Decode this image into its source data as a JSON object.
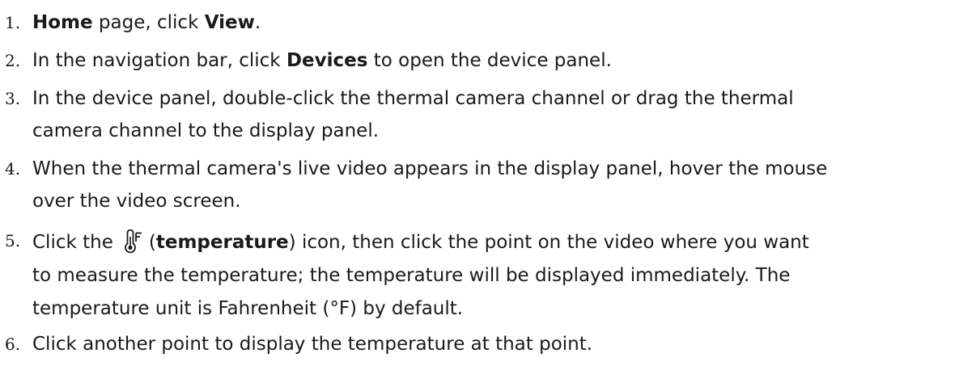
{
  "steps": [
    {
      "number": "1.",
      "parts": [
        {
          "text": "Home",
          "bold": true
        },
        {
          "text": " page, click ",
          "bold": false
        },
        {
          "text": "View",
          "bold": true
        },
        {
          "text": ".",
          "bold": false
        }
      ]
    },
    {
      "number": "2.",
      "parts": [
        {
          "text": "In the navigation bar, click ",
          "bold": false
        },
        {
          "text": "Devices",
          "bold": true
        },
        {
          "text": " to open the device panel.",
          "bold": false
        }
      ]
    },
    {
      "number": "3.",
      "line1": "In the device panel, double-click the thermal camera channel or drag the thermal",
      "line2": "camera channel to the display panel."
    },
    {
      "number": "4.",
      "line1": "When the thermal camera's live video appears in the display panel, hover the mouse",
      "line2": "over the video screen."
    },
    {
      "number": "5.",
      "prefix": "Click the",
      "icon": "thermometer-icon",
      "paren_open": "(",
      "bold_word": "temperature",
      "after_bold": ") icon, then click the point on the video where you want",
      "line2": "to measure the temperature; the temperature will be displayed immediately. The",
      "line3": "temperature unit is Fahrenheit (°F) by default."
    },
    {
      "number": "6.",
      "line1": "Click another point to display the temperature at that point."
    }
  ]
}
